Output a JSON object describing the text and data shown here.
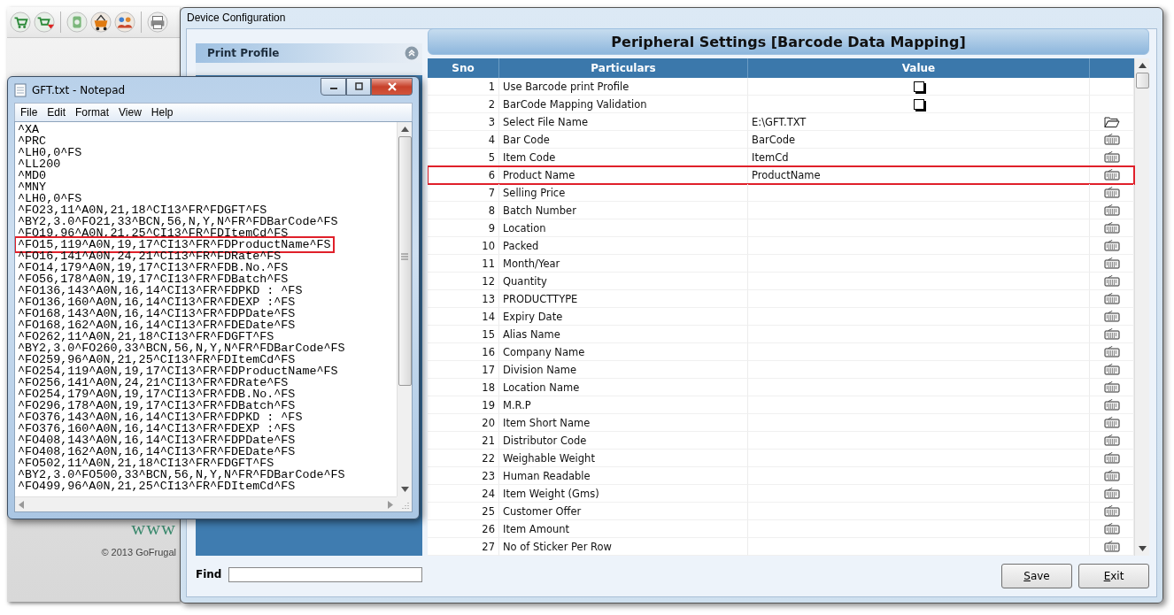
{
  "background_app": {
    "website": "www",
    "copyright": "© 2013 GoFrugal"
  },
  "device_window": {
    "title": "Device Configuration",
    "sidebar": {
      "header": "Print Profile",
      "expanded": true
    },
    "panel": {
      "title": "Peripheral Settings [Barcode Data Mapping]",
      "columns": [
        "Sno",
        "Particulars",
        "Value"
      ],
      "rows": [
        {
          "sno": "1",
          "particular": "Use Barcode print Profile",
          "kind": "checkbox",
          "checked": false,
          "highlighted": false
        },
        {
          "sno": "2",
          "particular": "BarCode Mapping Validation",
          "kind": "checkbox",
          "checked": false,
          "highlighted": false
        },
        {
          "sno": "3",
          "particular": "Select File Name",
          "kind": "file",
          "value": "E:\\GFT.TXT",
          "highlighted": false
        },
        {
          "sno": "4",
          "particular": "Bar Code",
          "kind": "text",
          "value": "BarCode",
          "highlighted": false
        },
        {
          "sno": "5",
          "particular": "Item Code",
          "kind": "text",
          "value": "ItemCd",
          "highlighted": false
        },
        {
          "sno": "6",
          "particular": "Product Name",
          "kind": "text",
          "value": "ProductName",
          "highlighted": true
        },
        {
          "sno": "7",
          "particular": "Selling Price",
          "kind": "text",
          "highlighted": false
        },
        {
          "sno": "8",
          "particular": "Batch Number",
          "kind": "text",
          "highlighted": false
        },
        {
          "sno": "9",
          "particular": "Location",
          "kind": "text",
          "highlighted": false
        },
        {
          "sno": "10",
          "particular": "Packed",
          "kind": "text",
          "highlighted": false
        },
        {
          "sno": "11",
          "particular": "Month/Year",
          "kind": "text",
          "highlighted": false
        },
        {
          "sno": "12",
          "particular": "Quantity",
          "kind": "text",
          "highlighted": false
        },
        {
          "sno": "13",
          "particular": "PRODUCTTYPE",
          "kind": "text",
          "highlighted": false
        },
        {
          "sno": "14",
          "particular": "Expiry Date",
          "kind": "text",
          "highlighted": false
        },
        {
          "sno": "15",
          "particular": "Alias Name",
          "kind": "text",
          "highlighted": false
        },
        {
          "sno": "16",
          "particular": "Company Name",
          "kind": "text",
          "highlighted": false
        },
        {
          "sno": "17",
          "particular": "Division Name",
          "kind": "text",
          "highlighted": false
        },
        {
          "sno": "18",
          "particular": "Location Name",
          "kind": "text",
          "highlighted": false
        },
        {
          "sno": "19",
          "particular": "M.R.P",
          "kind": "text",
          "highlighted": false
        },
        {
          "sno": "20",
          "particular": "Item Short Name",
          "kind": "text",
          "highlighted": false
        },
        {
          "sno": "21",
          "particular": "Distributor Code",
          "kind": "text",
          "highlighted": false
        },
        {
          "sno": "22",
          "particular": "Weighable Weight",
          "kind": "text",
          "highlighted": false
        },
        {
          "sno": "23",
          "particular": "Human Readable",
          "kind": "text",
          "highlighted": false
        },
        {
          "sno": "24",
          "particular": "Item Weight (Gms)",
          "kind": "text",
          "highlighted": false
        },
        {
          "sno": "25",
          "particular": "Customer Offer",
          "kind": "text",
          "highlighted": false
        },
        {
          "sno": "26",
          "particular": "Item Amount",
          "kind": "text",
          "highlighted": false
        },
        {
          "sno": "27",
          "particular": "No of Sticker Per Row",
          "kind": "text",
          "highlighted": false
        }
      ]
    },
    "find": {
      "label": "Find"
    },
    "buttons": [
      {
        "label": "Save"
      },
      {
        "label": "Exit"
      }
    ]
  },
  "notepad": {
    "title": "GFT.txt - Notepad",
    "menu": [
      "File",
      "Edit",
      "Format",
      "View",
      "Help"
    ],
    "lines": [
      {
        "text": "^XA",
        "highlighted": false
      },
      {
        "text": "^PRC",
        "highlighted": false
      },
      {
        "text": "^LH0,0^FS",
        "highlighted": false
      },
      {
        "text": "^LL200",
        "highlighted": false
      },
      {
        "text": "^MD0",
        "highlighted": false
      },
      {
        "text": "^MNY",
        "highlighted": false
      },
      {
        "text": "^LH0,0^FS",
        "highlighted": false
      },
      {
        "text": "^FO23,11^A0N,21,18^CI13^FR^FDGFT^FS",
        "highlighted": false
      },
      {
        "text": "^BY2,3.0^FO21,33^BCN,56,N,Y,N^FR^FDBarCode^FS",
        "highlighted": false
      },
      {
        "text": "^FO19,96^A0N,21,25^CI13^FR^FDItemCd^FS",
        "highlighted": false
      },
      {
        "text": "^FO15,119^A0N,19,17^CI13^FR^FDProductName^FS",
        "highlighted": true
      },
      {
        "text": "^FO16,141^A0N,24,21^CI13^FR^FDRate^FS",
        "highlighted": false
      },
      {
        "text": "^FO14,179^A0N,19,17^CI13^FR^FDB.No.^FS",
        "highlighted": false
      },
      {
        "text": "^FO56,178^A0N,19,17^CI13^FR^FDBatch^FS",
        "highlighted": false
      },
      {
        "text": "^FO136,143^A0N,16,14^CI13^FR^FDPKD : ^FS",
        "highlighted": false
      },
      {
        "text": "^FO136,160^A0N,16,14^CI13^FR^FDEXP :^FS",
        "highlighted": false
      },
      {
        "text": "^FO168,143^A0N,16,14^CI13^FR^FDPDate^FS",
        "highlighted": false
      },
      {
        "text": "^FO168,162^A0N,16,14^CI13^FR^FDEDate^FS",
        "highlighted": false
      },
      {
        "text": "^FO262,11^A0N,21,18^CI13^FR^FDGFT^FS",
        "highlighted": false
      },
      {
        "text": "^BY2,3.0^FO260,33^BCN,56,N,Y,N^FR^FDBarCode^FS",
        "highlighted": false
      },
      {
        "text": "^FO259,96^A0N,21,25^CI13^FR^FDItemCd^FS",
        "highlighted": false
      },
      {
        "text": "^FO254,119^A0N,19,17^CI13^FR^FDProductName^FS",
        "highlighted": false
      },
      {
        "text": "^FO256,141^A0N,24,21^CI13^FR^FDRate^FS",
        "highlighted": false
      },
      {
        "text": "^FO254,179^A0N,19,17^CI13^FR^FDB.No.^FS",
        "highlighted": false
      },
      {
        "text": "^FO296,178^A0N,19,17^CI13^FR^FDBatch^FS",
        "highlighted": false
      },
      {
        "text": "^FO376,143^A0N,16,14^CI13^FR^FDPKD : ^FS",
        "highlighted": false
      },
      {
        "text": "^FO376,160^A0N,16,14^CI13^FR^FDEXP :^FS",
        "highlighted": false
      },
      {
        "text": "^FO408,143^A0N,16,14^CI13^FR^FDPDate^FS",
        "highlighted": false
      },
      {
        "text": "^FO408,162^A0N,16,14^CI13^FR^FDEDate^FS",
        "highlighted": false
      },
      {
        "text": "^FO502,11^A0N,21,18^CI13^FR^FDGFT^FS",
        "highlighted": false
      },
      {
        "text": "^BY2,3.0^FO500,33^BCN,56,N,Y,N^FR^FDBarCode^FS",
        "highlighted": false
      },
      {
        "text": "^FO499,96^A0N,21,25^CI13^FR^FDItemCd^FS",
        "highlighted": false
      }
    ]
  }
}
